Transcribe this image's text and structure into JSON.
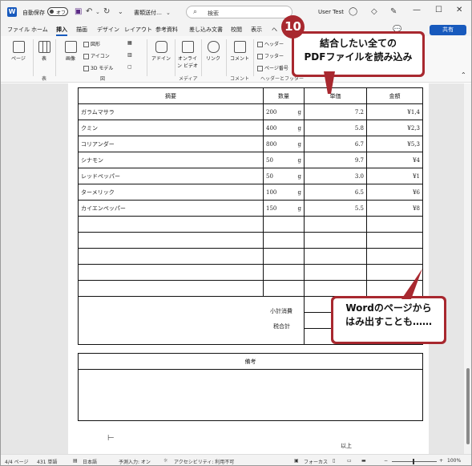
{
  "titlebar": {
    "app_letter": "W",
    "autosave_label": "自動保存",
    "autosave_state": "オフ",
    "doc_title": "書類送付…",
    "doc_title_chevron": "⌄",
    "search_placeholder": "検索",
    "user_name": "User Test"
  },
  "tabs": [
    "ファイル",
    "ホーム",
    "挿入",
    "描画",
    "デザイン",
    "レイアウト",
    "参考資料",
    "差し込み文書",
    "校閲",
    "表示",
    "ヘ"
  ],
  "active_tab": "挿入",
  "share_label": "共有",
  "ribbon": {
    "page_label": "ページ",
    "table_label": "表",
    "image_label": "画像",
    "shapes_label": "図形",
    "icons_label": "アイコン",
    "model3d_label": "3D モデル",
    "addins_label": "アドイン",
    "online_video_label": "オンライン ビデオ",
    "link_label": "リンク",
    "comment_label": "コメント",
    "header_label": "ヘッダー",
    "footer_label": "フッター",
    "page_number_label": "ページ番号",
    "groups": {
      "table": "表",
      "illustrations": "図",
      "media": "メディア",
      "comment": "コメント",
      "header_footer": "ヘッダーとフッター"
    }
  },
  "table": {
    "headers": [
      "摘要",
      "数量",
      "単価",
      "金額"
    ],
    "rows": [
      {
        "name": "ガラムマサラ",
        "qty": "200",
        "unit": "g",
        "price": "7.2",
        "amount": "¥1,4"
      },
      {
        "name": "クミン",
        "qty": "400",
        "unit": "g",
        "price": "5.8",
        "amount": "¥2,3"
      },
      {
        "name": "コリアンダー",
        "qty": "800",
        "unit": "g",
        "price": "6.7",
        "amount": "¥5,3"
      },
      {
        "name": "シナモン",
        "qty": "50",
        "unit": "g",
        "price": "9.7",
        "amount": "¥4"
      },
      {
        "name": "レッドペッパー",
        "qty": "50",
        "unit": "g",
        "price": "3.0",
        "amount": "¥1"
      },
      {
        "name": "ターメリック",
        "qty": "100",
        "unit": "g",
        "price": "6.5",
        "amount": "¥6"
      },
      {
        "name": "カイエンペッパー",
        "qty": "150",
        "unit": "g",
        "price": "5.5",
        "amount": "¥8"
      }
    ],
    "empty_rows": 5,
    "subtotal_label": "小計消費",
    "total_label": "税合計",
    "remarks_label": "備考",
    "closing": "以上"
  },
  "callouts": {
    "step_number": "10",
    "step_text_line1": "結合したい全ての",
    "step_text_line2": "PDFファイルを読み込み",
    "note_line1": "Wordのページから",
    "note_line2": "はみ出すことも……"
  },
  "statusbar": {
    "page": "4/4 ページ",
    "words": "431 単語",
    "language": "日本語",
    "predict": "予測入力: オン",
    "accessibility": "アクセシビリティ: 利用不可",
    "focus": "フォーカス",
    "zoom": "100%"
  },
  "colors": {
    "accent": "#185abd",
    "callout": "#a8282f"
  }
}
